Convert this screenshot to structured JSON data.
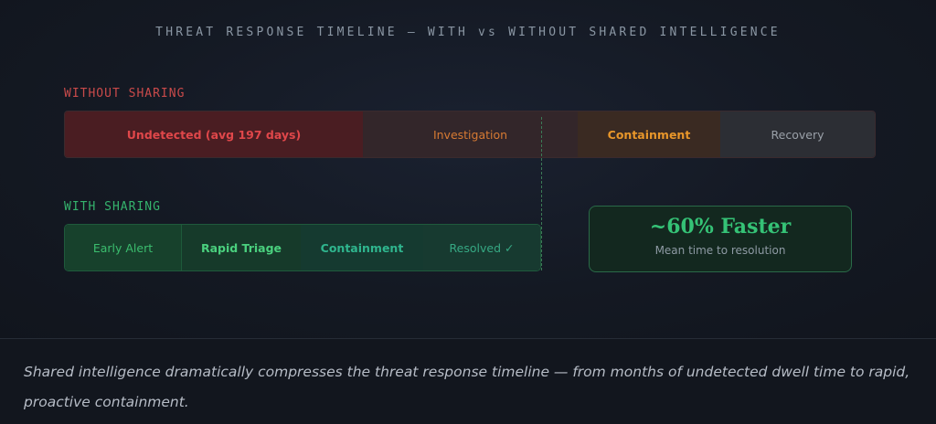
{
  "title": "THREAT RESPONSE TIMELINE — WITH vs WITHOUT SHARED INTELLIGENCE",
  "without": {
    "label": "WITHOUT SHARING",
    "segments": [
      "Undetected (avg 197 days)",
      "Investigation",
      "Containment",
      "Recovery"
    ]
  },
  "with": {
    "label": "WITH SHARING",
    "segments": [
      "Early Alert",
      "Rapid Triage",
      "Containment",
      "Resolved ✓"
    ]
  },
  "stat": {
    "value": "~60% Faster",
    "caption": "Mean time to resolution"
  },
  "caption": "Shared intelligence dramatically compresses the threat response timeline — from months of undetected dwell time to rapid, proactive containment.",
  "colors": {
    "without_accent": "#c94a4a",
    "with_accent": "#35b36d"
  }
}
